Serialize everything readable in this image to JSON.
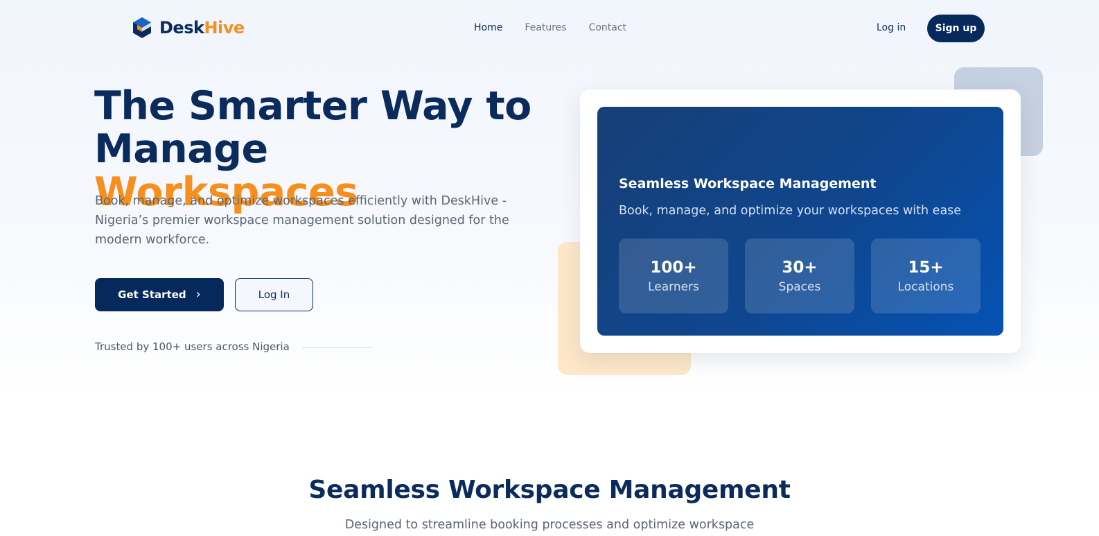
{
  "brand": {
    "name_part1": "Desk",
    "name_part2": "Hive"
  },
  "nav": {
    "links": [
      {
        "label": "Home",
        "active": true
      },
      {
        "label": "Features",
        "active": false
      },
      {
        "label": "Contact",
        "active": false
      }
    ],
    "login_label": "Log in",
    "signup_label": "Sign up"
  },
  "hero": {
    "title_line1": "The Smarter Way to",
    "title_line2_plain": "Manage",
    "title_line2_accent": "Workspaces",
    "subtitle": "Book, manage, and optimize workspaces efficiently with DeskHive - Nigeria’s premier workspace management solution designed for the modern workforce.",
    "primary_button": "Get Started",
    "secondary_button": "Log In",
    "trusted_text": "Trusted by 100+ users across Nigeria"
  },
  "card": {
    "title": "Seamless Workspace Management",
    "subtitle": "Book, manage, and optimize your workspaces with ease",
    "stats": [
      {
        "value": "100+",
        "label": "Learners"
      },
      {
        "value": "30+",
        "label": "Spaces"
      },
      {
        "value": "15+",
        "label": "Locations"
      }
    ]
  },
  "section": {
    "title": "Seamless Workspace Management",
    "subtitle": "Designed to streamline booking processes and optimize workspace"
  },
  "colors": {
    "navy": "#0b2b5c",
    "accent_orange": "#f5901e",
    "card_blue": "#0f468e"
  },
  "icons": {
    "logo": "hexagon-logo-icon",
    "primary_button": "chevron-right-icon"
  }
}
